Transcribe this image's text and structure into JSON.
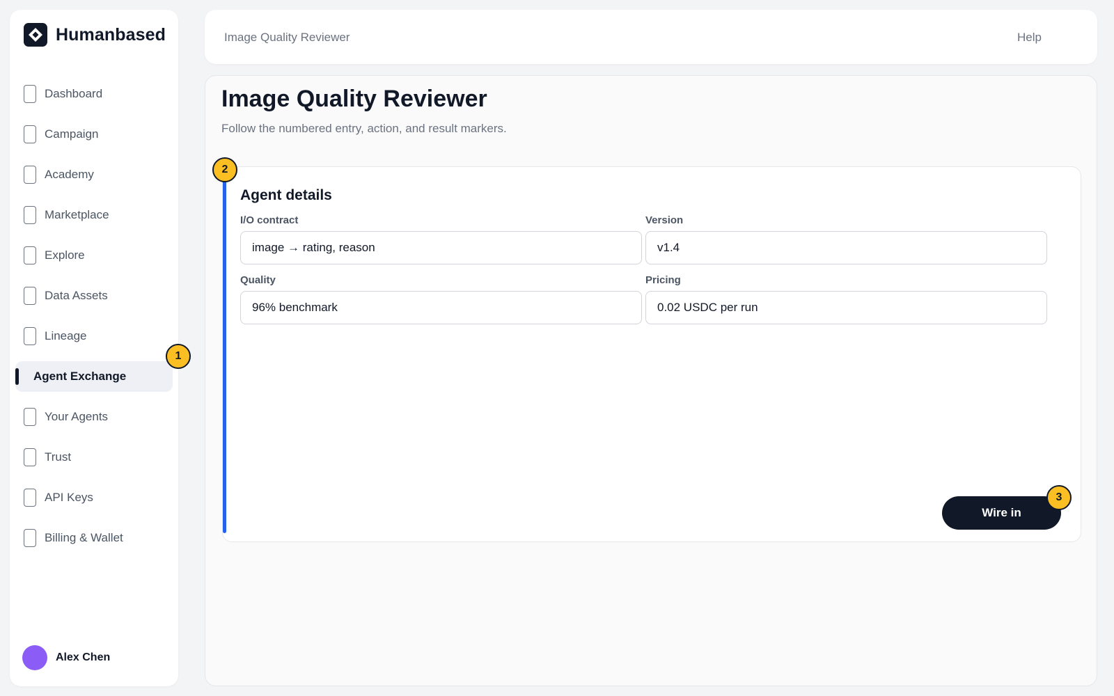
{
  "brand": {
    "name": "Humanbased"
  },
  "sidebar": {
    "items": [
      {
        "label": "Dashboard"
      },
      {
        "label": "Campaign"
      },
      {
        "label": "Academy"
      },
      {
        "label": "Marketplace"
      },
      {
        "label": "Explore"
      },
      {
        "label": "Data Assets"
      },
      {
        "label": "Lineage"
      },
      {
        "label": "Agent Exchange"
      },
      {
        "label": "Your Agents"
      },
      {
        "label": "Trust"
      },
      {
        "label": "API Keys"
      },
      {
        "label": "Billing & Wallet"
      }
    ],
    "active": "Agent Exchange"
  },
  "user": {
    "name": "Alex Chen",
    "avatar_color": "#8b5cf6"
  },
  "topbar": {
    "breadcrumb": "Image Quality Reviewer",
    "help_label": "Help"
  },
  "main": {
    "title": "Image Quality Reviewer",
    "subtitle": "Follow the numbered entry, action, and result markers."
  },
  "card": {
    "title": "Agent details",
    "fields": {
      "io_contract": {
        "label": "I/O contract",
        "value": "image → rating, reason"
      },
      "version": {
        "label": "Version",
        "value": "v1.4"
      },
      "quality": {
        "label": "Quality",
        "value": "96% benchmark"
      },
      "pricing": {
        "label": "Pricing",
        "value": "0.02 USDC per run"
      }
    },
    "action_label": "Wire in"
  },
  "markers": [
    "1",
    "2",
    "3"
  ],
  "colors": {
    "accent": "#2563eb",
    "marker": "#fbbf24",
    "dark": "#111827"
  }
}
